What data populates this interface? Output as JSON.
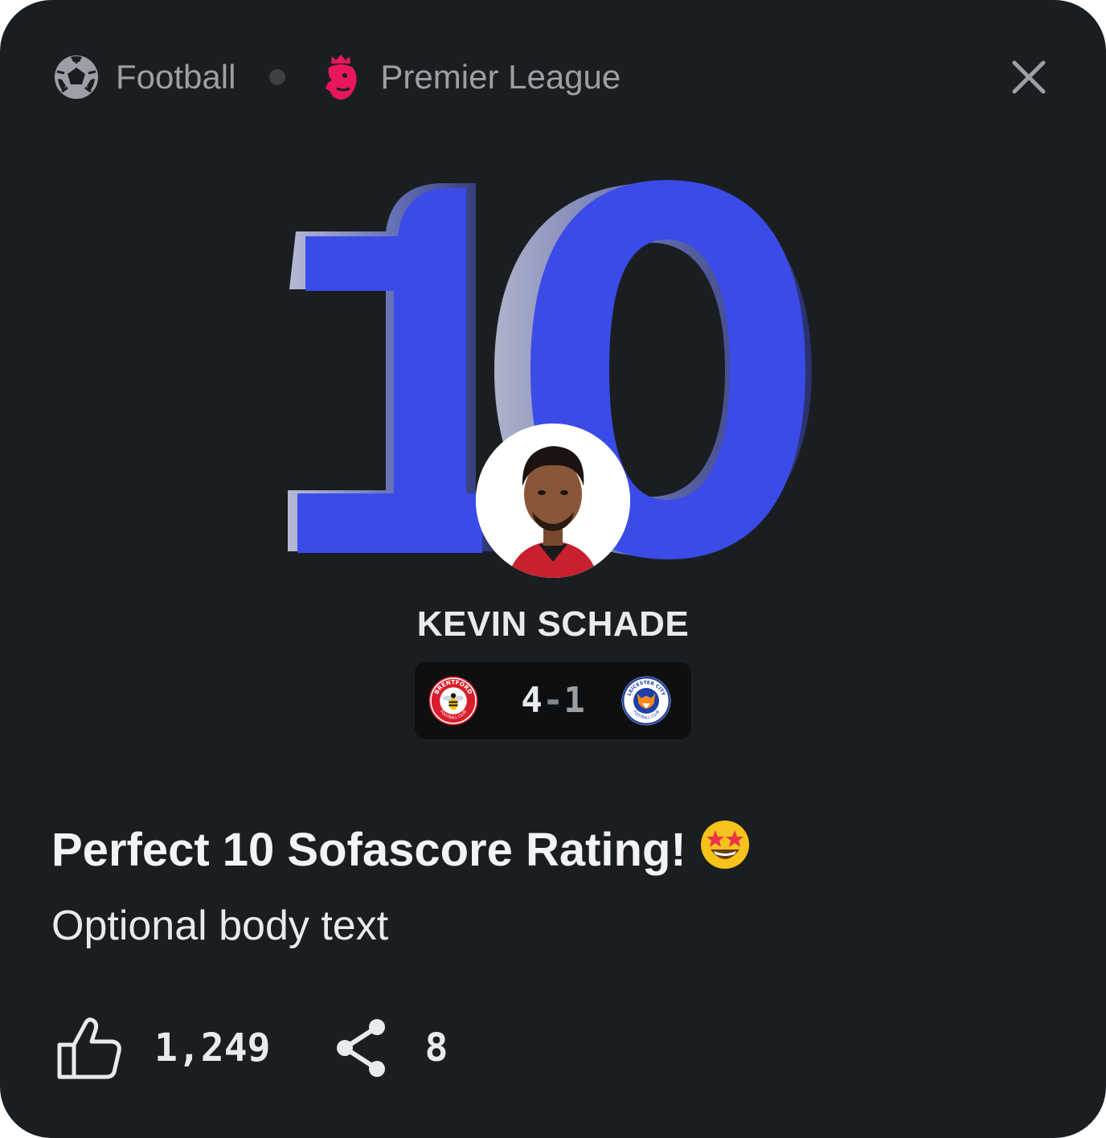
{
  "header": {
    "sport_label": "Football",
    "sport_icon": "football-icon",
    "league_label": "Premier League",
    "league_icon": "premier-league-lion-icon",
    "close_icon": "close-icon"
  },
  "hero": {
    "rating": "10",
    "rating_color": "#3a4be8"
  },
  "player": {
    "name": "KEVIN SCHADE"
  },
  "match": {
    "home_team_crest": "brentford-crest",
    "home_crest_text": "BRENTFORD",
    "home_crest_bottom_text": "FOOTBALL CLUB",
    "home_score": "4",
    "separator": "-",
    "away_score": "1",
    "away_team_crest": "leicester-city-crest",
    "away_crest_text": "LEICESTER CITY",
    "away_crest_bottom_text": "FOOTBALL CLUB"
  },
  "post": {
    "title": "Perfect 10 Sofascore Rating!",
    "title_emoji": "star-struck-emoji",
    "body": "Optional body text"
  },
  "footer": {
    "like_icon": "thumbs-up-icon",
    "likes": "1,249",
    "share_icon": "share-icon",
    "shares": "8"
  }
}
